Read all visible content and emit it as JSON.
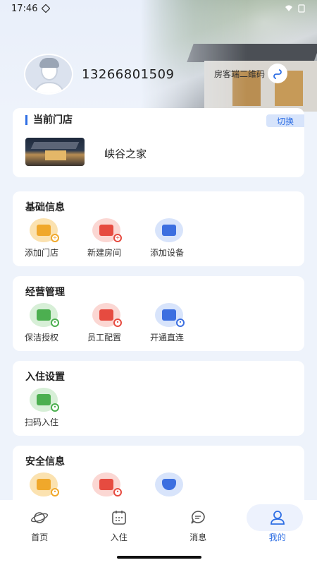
{
  "status_bar": {
    "time": "17:46"
  },
  "profile": {
    "phone": "13266801509",
    "qr_label": "房客端二维码"
  },
  "current_store": {
    "title": "当前门店",
    "switch_label": "切换",
    "store_name": "峡谷之家"
  },
  "sections": {
    "basic": {
      "title": "基础信息",
      "items": [
        {
          "label": "添加门店",
          "icon": "store-add-icon"
        },
        {
          "label": "新建房间",
          "icon": "room-add-icon"
        },
        {
          "label": "添加设备",
          "icon": "device-add-icon"
        }
      ]
    },
    "operations": {
      "title": "经营管理",
      "items": [
        {
          "label": "保洁授权",
          "icon": "cleaning-icon"
        },
        {
          "label": "员工配置",
          "icon": "staff-icon"
        },
        {
          "label": "开通直连",
          "icon": "direct-connect-icon"
        }
      ]
    },
    "checkin": {
      "title": "入住设置",
      "items": [
        {
          "label": "扫码入住",
          "icon": "scan-checkin-icon"
        }
      ]
    },
    "security": {
      "title": "安全信息",
      "items": [
        {
          "label": "",
          "icon": "lock-icon"
        },
        {
          "label": "",
          "icon": "bed-icon"
        },
        {
          "label": "",
          "icon": "shield-icon"
        }
      ]
    }
  },
  "tabbar": {
    "tabs": [
      {
        "label": "首页",
        "icon": "planet-icon"
      },
      {
        "label": "入住",
        "icon": "calendar-icon"
      },
      {
        "label": "消息",
        "icon": "message-icon"
      },
      {
        "label": "我的",
        "icon": "user-icon"
      }
    ],
    "active_index": 3
  },
  "colors": {
    "accent": "#2f6fe4",
    "background": "#eef3fb"
  }
}
